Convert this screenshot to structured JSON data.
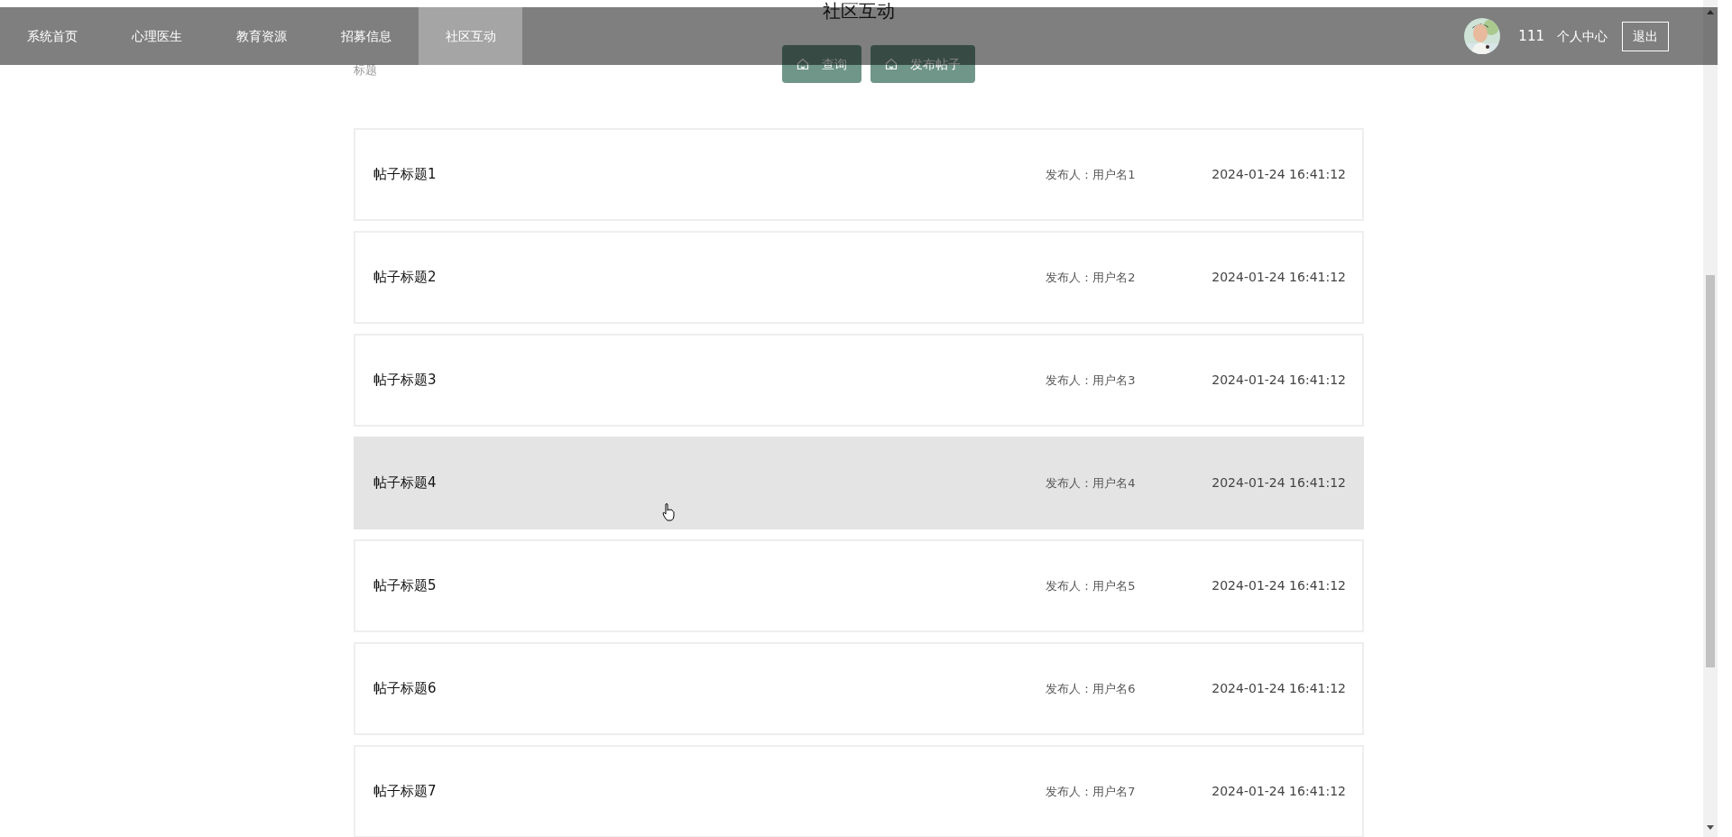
{
  "nav": {
    "items": [
      {
        "label": "系统首页",
        "selected": false
      },
      {
        "label": "心理医生",
        "selected": false
      },
      {
        "label": "教育资源",
        "selected": false
      },
      {
        "label": "招募信息",
        "selected": false
      },
      {
        "label": "社区互动",
        "selected": true
      }
    ],
    "user": {
      "name": "111",
      "profile_link": "个人中心",
      "logout": "退出"
    }
  },
  "page": {
    "title": "社区互动",
    "search_label": "标题",
    "buttons": [
      "查询",
      "发布帖子"
    ]
  },
  "posts": [
    {
      "title": "帖子标题1",
      "author": "发布人：用户名1",
      "time": "2024-01-24 16:41:12",
      "hovered": false
    },
    {
      "title": "帖子标题2",
      "author": "发布人：用户名2",
      "time": "2024-01-24 16:41:12",
      "hovered": false
    },
    {
      "title": "帖子标题3",
      "author": "发布人：用户名3",
      "time": "2024-01-24 16:41:12",
      "hovered": false
    },
    {
      "title": "帖子标题4",
      "author": "发布人：用户名4",
      "time": "2024-01-24 16:41:12",
      "hovered": true
    },
    {
      "title": "帖子标题5",
      "author": "发布人：用户名5",
      "time": "2024-01-24 16:41:12",
      "hovered": false
    },
    {
      "title": "帖子标题6",
      "author": "发布人：用户名6",
      "time": "2024-01-24 16:41:12",
      "hovered": false
    },
    {
      "title": "帖子标题7",
      "author": "发布人：用户名7",
      "time": "2024-01-24 16:41:12",
      "hovered": false
    }
  ]
}
